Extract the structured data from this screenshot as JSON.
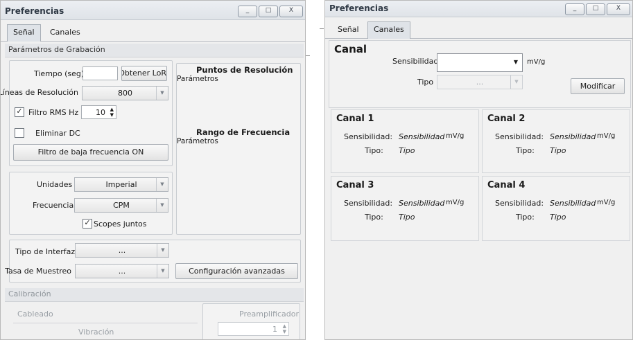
{
  "left": {
    "title": "Preferencias",
    "win_buttons": {
      "minimize": "_",
      "maximize": "□",
      "close": "X"
    },
    "tabs": [
      "Señal",
      "Canales"
    ],
    "section_title": "Parámetros de Grabación",
    "tiempo_label": "Tiempo (seg)",
    "tiempo_value": "",
    "obtener_button": "Obtener LoR",
    "lineas_label": "Líneas de Resolución",
    "lineas_value": "800",
    "filtro_rms_label": "Filtro RMS Hz",
    "filtro_rms_value": "10",
    "filtro_rms_checked": true,
    "eliminar_dc_label": "Eliminar DC",
    "eliminar_dc_checked": false,
    "filtro_baja_button": "Filtro de baja frecuencia ON",
    "unidades_label": "Unidades",
    "unidades_value": "Imperial",
    "frecuencia_label": "Frecuencia",
    "frecuencia_value": "CPM",
    "scopes_label": "Scopes juntos",
    "scopes_checked": true,
    "puntos_title": "Puntos de Resolución",
    "puntos_sub": "Parámetros",
    "rango_title": "Rango de Frecuencia",
    "rango_sub": "Parámetros",
    "tipo_interfaz_label": "Tipo de Interfaz",
    "tipo_interfaz_value": "...",
    "tasa_label": "Tasa de Muestreo",
    "tasa_value": "...",
    "config_button": "Configuración avanzadas",
    "calibracion_title": "Calibración",
    "cableado_label": "Cableado",
    "preamp_label": "Preamplificador",
    "preamp_value": "1",
    "vibracion_label": "Vibración"
  },
  "right": {
    "title": "Preferencias",
    "win_buttons": {
      "minimize": "_",
      "maximize": "□",
      "close": "X"
    },
    "tabs": [
      "Señal",
      "Canales"
    ],
    "canal_title": "Canal",
    "sensibilidad_label": "Sensibilidad",
    "sensibilidad_value": "",
    "unit": "mV/g",
    "tipo_label": "Tipo",
    "tipo_value": "...",
    "modificar_button": "Modificar",
    "channels": [
      {
        "name": "Canal 1",
        "sens_label": "Sensibilidad:",
        "sens_value": "Sensibilidad",
        "unit": "mV/g",
        "tipo_label": "Tipo:",
        "tipo_value": "Tipo"
      },
      {
        "name": "Canal 2",
        "sens_label": "Sensibilidad:",
        "sens_value": "Sensibilidad",
        "unit": "mV/g",
        "tipo_label": "Tipo:",
        "tipo_value": "Tipo"
      },
      {
        "name": "Canal 3",
        "sens_label": "Sensibilidad:",
        "sens_value": "Sensibilidad",
        "unit": "mV/g",
        "tipo_label": "Tipo:",
        "tipo_value": "Tipo"
      },
      {
        "name": "Canal 4",
        "sens_label": "Sensibilidad:",
        "sens_value": "Sensibilidad",
        "unit": "mV/g",
        "tipo_label": "Tipo:",
        "tipo_value": "Tipo"
      }
    ]
  }
}
